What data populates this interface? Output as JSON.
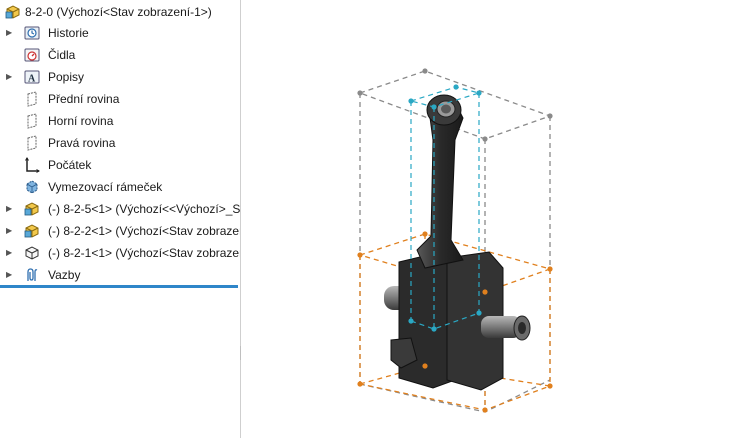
{
  "tree": {
    "root_label": "8-2-0  (Výchozí<Stav zobrazení-1>)",
    "items": [
      {
        "label": "Historie",
        "icon": "history-icon",
        "expandable": true
      },
      {
        "label": "Čidla",
        "icon": "sensors-icon",
        "expandable": false
      },
      {
        "label": "Popisy",
        "icon": "annotations-icon",
        "expandable": true
      },
      {
        "label": "Přední rovina",
        "icon": "plane-icon",
        "expandable": false
      },
      {
        "label": "Horní rovina",
        "icon": "plane-icon",
        "expandable": false
      },
      {
        "label": "Pravá rovina",
        "icon": "plane-icon",
        "expandable": false
      },
      {
        "label": "Počátek",
        "icon": "origin-icon",
        "expandable": false
      },
      {
        "label": "Vymezovací rámeček",
        "icon": "bounding-box-icon",
        "expandable": false
      },
      {
        "label": "(-) 8-2-5<1> (Výchozí<<Výchozí>_S",
        "icon": "assembly-part-icon",
        "expandable": true
      },
      {
        "label": "(-) 8-2-2<1> (Výchozí<Stav zobrazer",
        "icon": "assembly-part-icon",
        "expandable": true
      },
      {
        "label": "(-) 8-2-1<1> (Výchozí<Stav zobrazer",
        "icon": "part-icon",
        "expandable": true
      },
      {
        "label": "Vazby",
        "icon": "mates-icon",
        "expandable": true
      }
    ]
  },
  "colors": {
    "accent": "#2f86c9",
    "bbox_gray": "#8a8a8a",
    "bbox_cyan": "#2aa8c4",
    "bbox_orange": "#e0801e",
    "part_dark": "#2c2c2c"
  }
}
